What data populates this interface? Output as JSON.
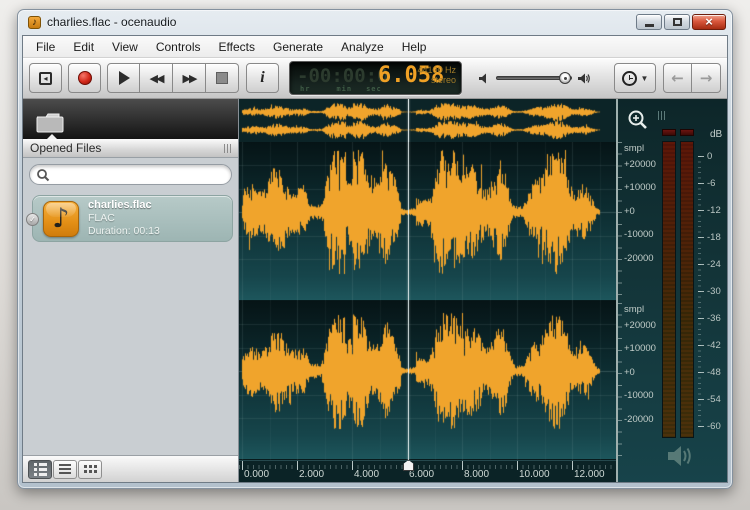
{
  "window": {
    "title": "charlies.flac - ocenaudio"
  },
  "menu": {
    "items": [
      "File",
      "Edit",
      "View",
      "Controls",
      "Effects",
      "Generate",
      "Analyze",
      "Help"
    ]
  },
  "toolbar": {
    "time_display": {
      "ghost": "-00:00:0",
      "value": "6.058",
      "unit_hr": "hr",
      "unit_min": "min",
      "unit_sec": "sec",
      "sample_rate": "44100 Hz",
      "channel_mode": "stereo"
    }
  },
  "sidebar": {
    "panel_title": "Opened Files",
    "search_value": "",
    "file": {
      "name": "charlies.flac",
      "format": "FLAC",
      "duration": "Duration: 00:13",
      "check": "✓"
    }
  },
  "waveform": {
    "amp_ticks": [
      "smpl",
      "+20000",
      "+10000",
      "+0",
      "-10000",
      "-20000"
    ],
    "playhead_seconds": "6.058",
    "duration_label": "00:13"
  },
  "timeline": {
    "labels": [
      "0.000",
      "2.000",
      "4.000",
      "6.000",
      "8.000",
      "10.000",
      "12.000"
    ]
  },
  "meters": {
    "db_label": "dB",
    "db_ticks": [
      "0",
      "-6",
      "-12",
      "-18",
      "-24",
      "-30",
      "-36",
      "-42",
      "-48",
      "-54",
      "-60"
    ]
  },
  "colors": {
    "waveform_orange": "#f0a42c",
    "panel_teal": "#123438",
    "time_digits": "#f0a125"
  },
  "icons": {
    "note": "♪",
    "close": "×",
    "back": "←",
    "forward": "→",
    "dropdown": "▼",
    "rewind": "◀◀",
    "forward2": "▶▶",
    "skip": "◂"
  }
}
